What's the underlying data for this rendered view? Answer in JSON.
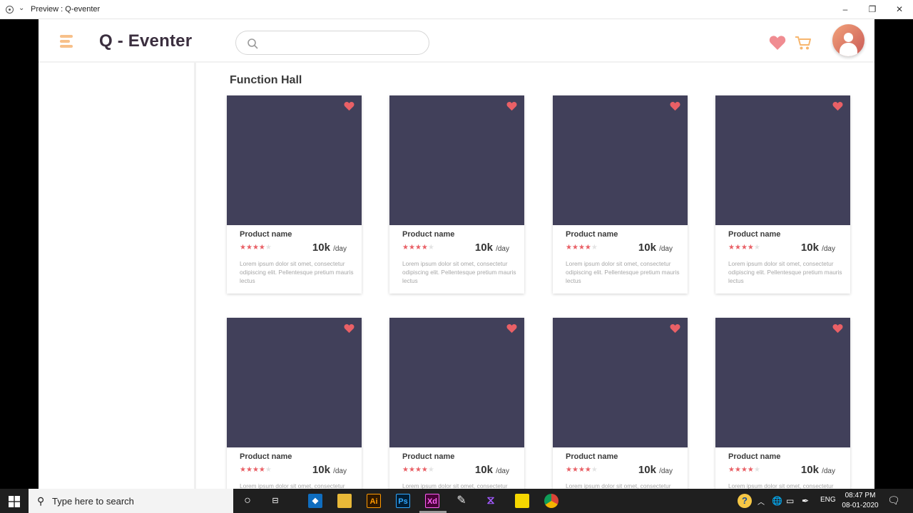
{
  "window": {
    "title": "Preview : Q-eventer",
    "controls": [
      "minimize",
      "maximize",
      "close"
    ]
  },
  "app": {
    "brand": "Q - Eventer",
    "search": {
      "placeholder": "",
      "value": ""
    },
    "header_icons": [
      "heart-icon",
      "cart-icon",
      "avatar"
    ],
    "section_title": "Function Hall",
    "colors": {
      "card_image": "#41405a",
      "accent_heart": "#e96066",
      "menu_icon": "#f7c08a",
      "cart_icon": "#f7b66e"
    },
    "cards": [
      {
        "name": "Product name",
        "rating": 4,
        "price": "10k",
        "unit": "/day",
        "desc": "Lorem ipsum dolor sit omet, consectetur odipiscing elit. Pellentesque pretium mauris lectus"
      },
      {
        "name": "Product name",
        "rating": 4,
        "price": "10k",
        "unit": "/day",
        "desc": "Lorem ipsum dolor sit omet, consectetur odipiscing elit. Pellentesque pretium mauris lectus"
      },
      {
        "name": "Product name",
        "rating": 4,
        "price": "10k",
        "unit": "/day",
        "desc": "Lorem ipsum dolor sit omet, consectetur odipiscing elit. Pellentesque pretium mauris lectus"
      },
      {
        "name": "Product name",
        "rating": 4,
        "price": "10k",
        "unit": "/day",
        "desc": "Lorem ipsum dolor sit omet, consectetur odipiscing elit. Pellentesque pretium mauris lectus"
      },
      {
        "name": "Product name",
        "rating": 4,
        "price": "10k",
        "unit": "/day",
        "desc": "Lorem ipsum dolor sit omet, consectetur odipiscing elit. Pellentesque pretium mauris lectus"
      },
      {
        "name": "Product name",
        "rating": 4,
        "price": "10k",
        "unit": "/day",
        "desc": "Lorem ipsum dolor sit omet, consectetur odipiscing elit. Pellentesque pretium mauris lectus"
      },
      {
        "name": "Product name",
        "rating": 4,
        "price": "10k",
        "unit": "/day",
        "desc": "Lorem ipsum dolor sit omet, consectetur odipiscing elit. Pellentesque pretium mauris lectus"
      },
      {
        "name": "Product name",
        "rating": 4,
        "price": "10k",
        "unit": "/day",
        "desc": "Lorem ipsum dolor sit omet, consectetur odipiscing elit. Pellentesque pretium mauris lectus"
      }
    ]
  },
  "taskbar": {
    "search_text": "Type here to search",
    "apps": [
      "cortana-icon",
      "task-view-icon",
      "vscode-icon",
      "file-explorer-icon",
      "illustrator-icon",
      "photoshop-icon",
      "xd-icon",
      "pencil-app-icon",
      "visual-studio-icon",
      "sticky-notes-icon",
      "chrome-icon"
    ],
    "app_labels": {
      "illustrator": "Ai",
      "photoshop": "Ps",
      "xd": "Xd"
    },
    "tray_lang": "ENG",
    "time": "08:47 PM",
    "date": "08-01-2020"
  }
}
